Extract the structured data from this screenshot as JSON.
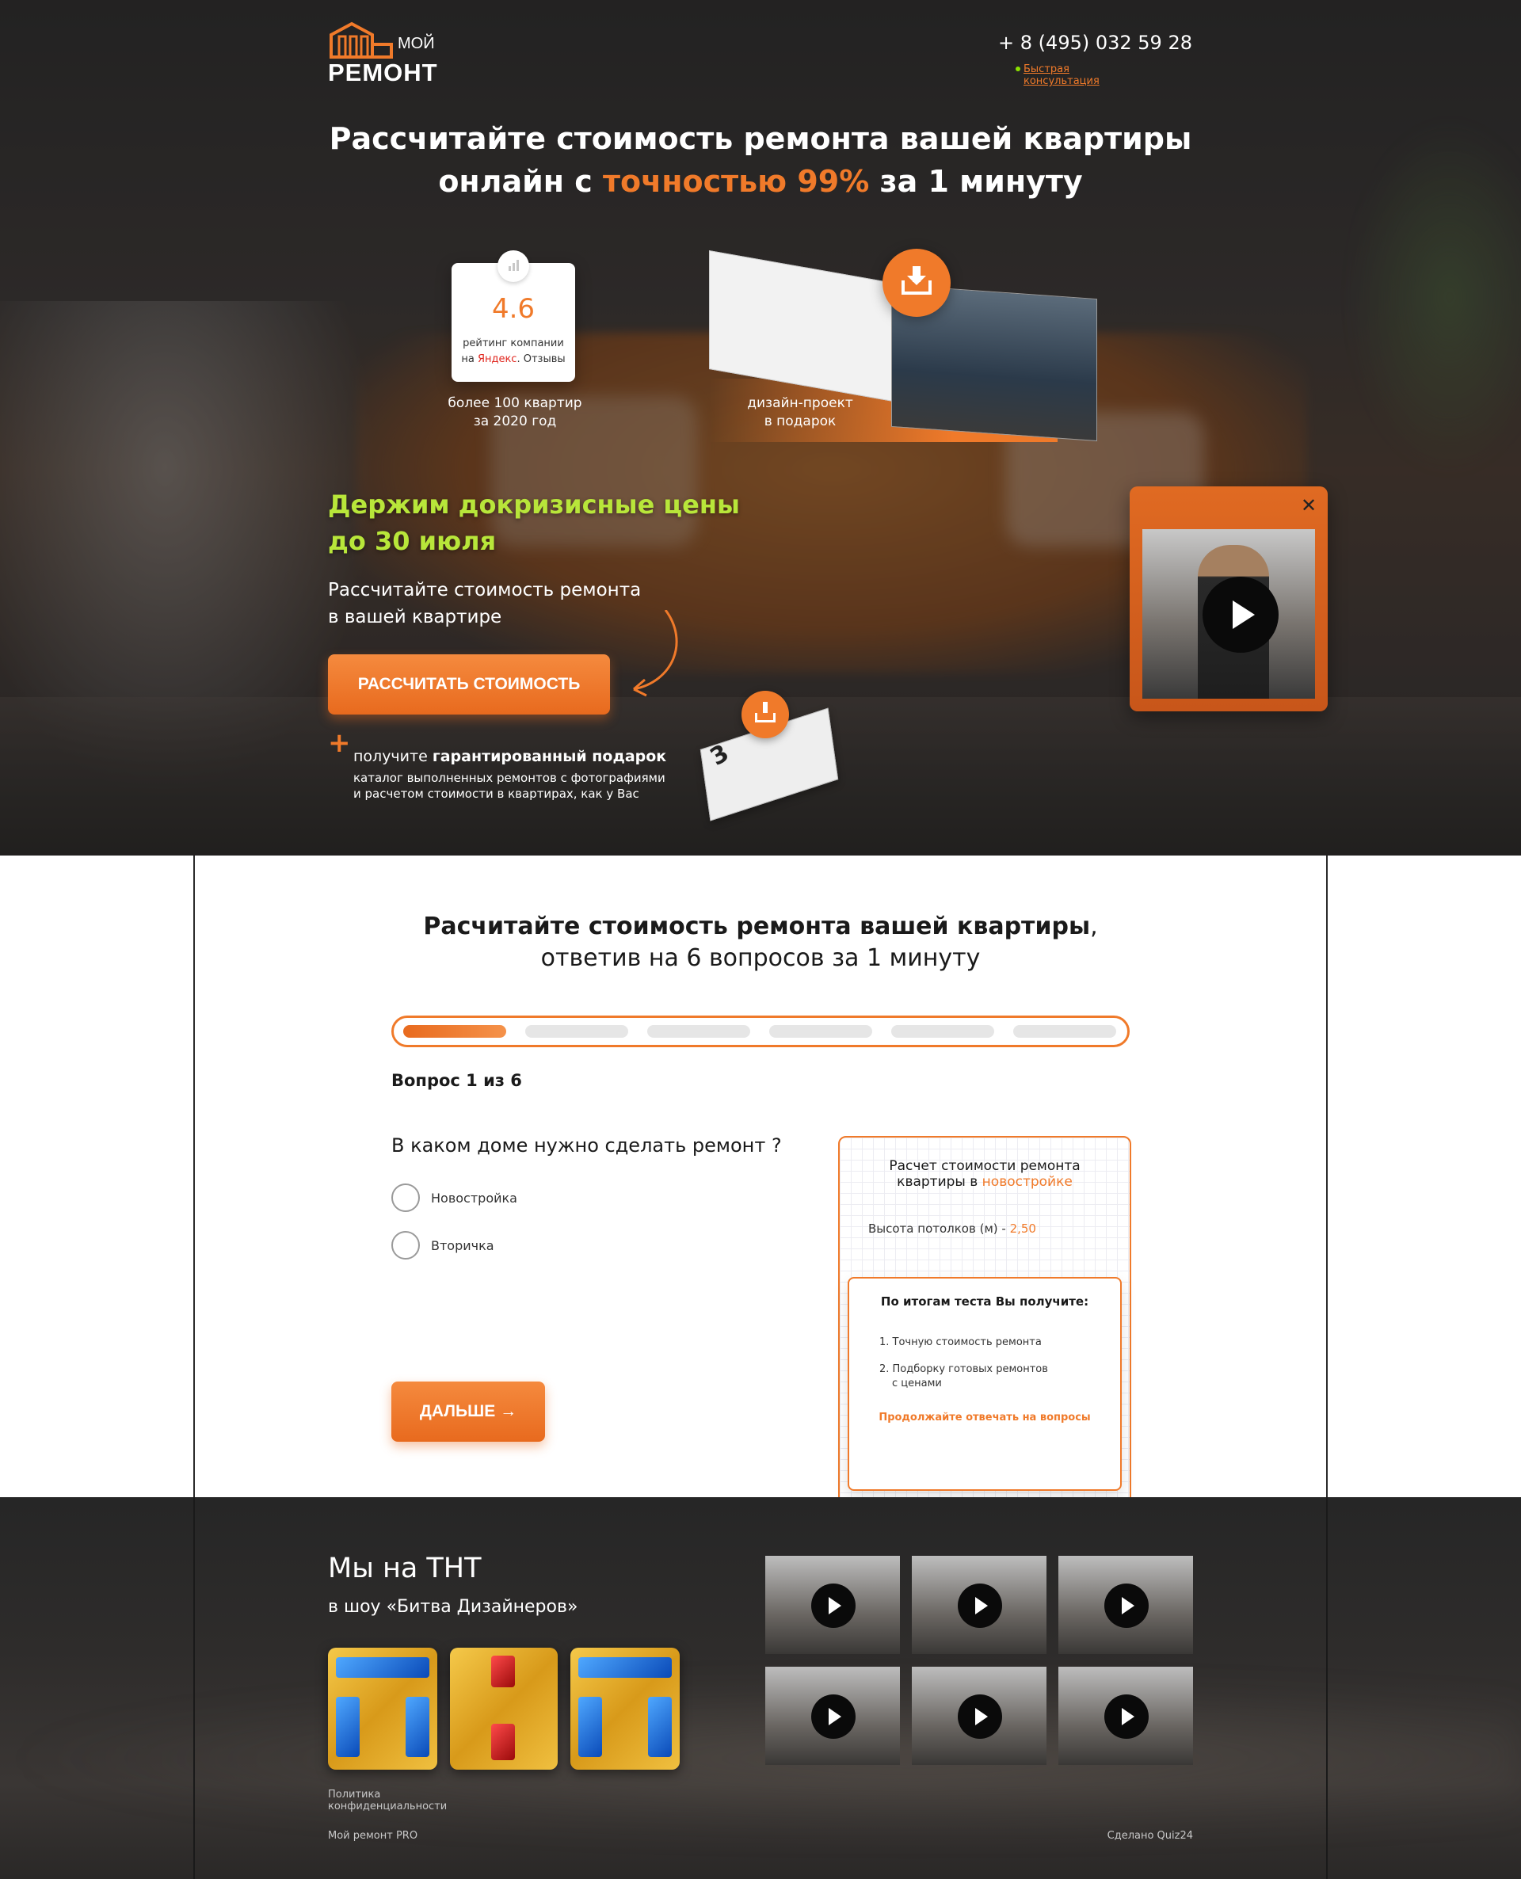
{
  "header": {
    "logo_top": "МОЙ",
    "logo_bottom": "РЕМОНТ",
    "phone": "+ 8 (495) 032 59 28",
    "consult_link": "Быстрая консультация"
  },
  "hero": {
    "title_part1": "Рассчитайте стоимость ремонта вашей квартиры",
    "title_part2": "онлайн с ",
    "title_accent": "точностью 99%",
    "title_part3": " за 1 минуту",
    "rating_value": "4.6",
    "rating_text1": "рейтинг компании",
    "rating_text2_pre": "на ",
    "rating_text2_ya": "Яндекс",
    "rating_text2_post": ". Отзывы",
    "stat_line1": "более 100 квартир",
    "stat_line2": "за 2020 год",
    "design_line1": "дизайн-проект",
    "design_line2": "в подарок",
    "promo_line1": "Держим докризисные цены",
    "promo_line2": "до 30 июля",
    "promo_sub_line1": "Рассчитайте стоимость ремонта",
    "promo_sub_line2": "в вашей квартире",
    "cta_label": "РАССЧИТАТЬ СТОИМОСТЬ",
    "gift_pre": "получите ",
    "gift_bold": "гарантированный подарок",
    "gift_desc_line1": "каталог выполненных ремонтов с фотографиями",
    "gift_desc_line2": "и расчетом стоимости в квартирах, как у Вас",
    "catalog_number": "3",
    "video_close": "✕"
  },
  "quiz": {
    "title_bold": "Расчитайте стоимость ремонта вашей квартиры",
    "title_comma": ",",
    "title_line2": "ответив на 6 вопросов за 1 минуту",
    "progress": {
      "current": 1,
      "total": 6
    },
    "counter": "Вопрос 1 из 6",
    "question": "В каком доме нужно сделать ремонт ?",
    "options": [
      "Новостройка",
      "Вторичка"
    ],
    "next_label": "ДАЛЬШЕ  →",
    "calc_title_line1": "Расчет стоимости ремонта",
    "calc_title_line2_pre": "квартиры в ",
    "calc_title_line2_accent": "новостройке",
    "calc_param_label": "Высота потолков (м) - ",
    "calc_param_value": "2,50",
    "result_title": "По итогам теста Вы получите:",
    "result_item1": "1. Точную стоимость ремонта",
    "result_item2_line1": "2. Подборку готовых ремонтов",
    "result_item2_line2": "с ценами",
    "result_cta": "Продолжайте отвечать на вопросы"
  },
  "footer": {
    "tnt_title": "Мы на ТНТ",
    "tnt_sub": "в шоу «Битва Дизайнеров»",
    "policy_line1": "Политика",
    "policy_line2": "конфиденциальности",
    "brand": "Мой ремонт PRO",
    "made_by": "Сделано Quiz24"
  },
  "colors": {
    "accent": "#f07a2a",
    "promo_green": "#b8e63a",
    "dark_bg": "#2a2a2a"
  }
}
